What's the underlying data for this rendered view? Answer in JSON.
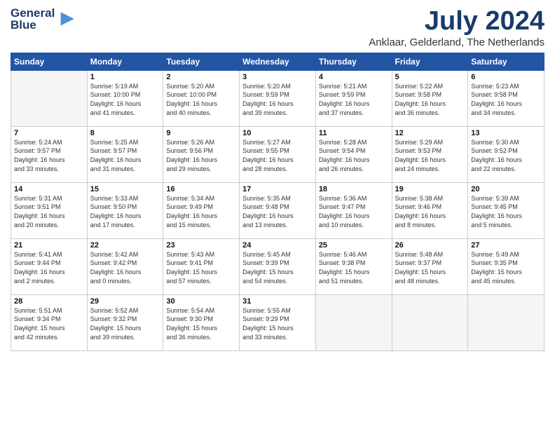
{
  "logo": {
    "line1": "General",
    "line2": "Blue"
  },
  "title": "July 2024",
  "subtitle": "Anklaar, Gelderland, The Netherlands",
  "days_of_week": [
    "Sunday",
    "Monday",
    "Tuesday",
    "Wednesday",
    "Thursday",
    "Friday",
    "Saturday"
  ],
  "weeks": [
    [
      {
        "day": "",
        "content": ""
      },
      {
        "day": "1",
        "content": "Sunrise: 5:19 AM\nSunset: 10:00 PM\nDaylight: 16 hours\nand 41 minutes."
      },
      {
        "day": "2",
        "content": "Sunrise: 5:20 AM\nSunset: 10:00 PM\nDaylight: 16 hours\nand 40 minutes."
      },
      {
        "day": "3",
        "content": "Sunrise: 5:20 AM\nSunset: 9:59 PM\nDaylight: 16 hours\nand 39 minutes."
      },
      {
        "day": "4",
        "content": "Sunrise: 5:21 AM\nSunset: 9:59 PM\nDaylight: 16 hours\nand 37 minutes."
      },
      {
        "day": "5",
        "content": "Sunrise: 5:22 AM\nSunset: 9:58 PM\nDaylight: 16 hours\nand 36 minutes."
      },
      {
        "day": "6",
        "content": "Sunrise: 5:23 AM\nSunset: 9:58 PM\nDaylight: 16 hours\nand 34 minutes."
      }
    ],
    [
      {
        "day": "7",
        "content": "Sunrise: 5:24 AM\nSunset: 9:57 PM\nDaylight: 16 hours\nand 33 minutes."
      },
      {
        "day": "8",
        "content": "Sunrise: 5:25 AM\nSunset: 9:57 PM\nDaylight: 16 hours\nand 31 minutes."
      },
      {
        "day": "9",
        "content": "Sunrise: 5:26 AM\nSunset: 9:56 PM\nDaylight: 16 hours\nand 29 minutes."
      },
      {
        "day": "10",
        "content": "Sunrise: 5:27 AM\nSunset: 9:55 PM\nDaylight: 16 hours\nand 28 minutes."
      },
      {
        "day": "11",
        "content": "Sunrise: 5:28 AM\nSunset: 9:54 PM\nDaylight: 16 hours\nand 26 minutes."
      },
      {
        "day": "12",
        "content": "Sunrise: 5:29 AM\nSunset: 9:53 PM\nDaylight: 16 hours\nand 24 minutes."
      },
      {
        "day": "13",
        "content": "Sunrise: 5:30 AM\nSunset: 9:52 PM\nDaylight: 16 hours\nand 22 minutes."
      }
    ],
    [
      {
        "day": "14",
        "content": "Sunrise: 5:31 AM\nSunset: 9:51 PM\nDaylight: 16 hours\nand 20 minutes."
      },
      {
        "day": "15",
        "content": "Sunrise: 5:33 AM\nSunset: 9:50 PM\nDaylight: 16 hours\nand 17 minutes."
      },
      {
        "day": "16",
        "content": "Sunrise: 5:34 AM\nSunset: 9:49 PM\nDaylight: 16 hours\nand 15 minutes."
      },
      {
        "day": "17",
        "content": "Sunrise: 5:35 AM\nSunset: 9:48 PM\nDaylight: 16 hours\nand 13 minutes."
      },
      {
        "day": "18",
        "content": "Sunrise: 5:36 AM\nSunset: 9:47 PM\nDaylight: 16 hours\nand 10 minutes."
      },
      {
        "day": "19",
        "content": "Sunrise: 5:38 AM\nSunset: 9:46 PM\nDaylight: 16 hours\nand 8 minutes."
      },
      {
        "day": "20",
        "content": "Sunrise: 5:39 AM\nSunset: 9:45 PM\nDaylight: 16 hours\nand 5 minutes."
      }
    ],
    [
      {
        "day": "21",
        "content": "Sunrise: 5:41 AM\nSunset: 9:44 PM\nDaylight: 16 hours\nand 2 minutes."
      },
      {
        "day": "22",
        "content": "Sunrise: 5:42 AM\nSunset: 9:42 PM\nDaylight: 16 hours\nand 0 minutes."
      },
      {
        "day": "23",
        "content": "Sunrise: 5:43 AM\nSunset: 9:41 PM\nDaylight: 15 hours\nand 57 minutes."
      },
      {
        "day": "24",
        "content": "Sunrise: 5:45 AM\nSunset: 9:39 PM\nDaylight: 15 hours\nand 54 minutes."
      },
      {
        "day": "25",
        "content": "Sunrise: 5:46 AM\nSunset: 9:38 PM\nDaylight: 15 hours\nand 51 minutes."
      },
      {
        "day": "26",
        "content": "Sunrise: 5:48 AM\nSunset: 9:37 PM\nDaylight: 15 hours\nand 48 minutes."
      },
      {
        "day": "27",
        "content": "Sunrise: 5:49 AM\nSunset: 9:35 PM\nDaylight: 15 hours\nand 45 minutes."
      }
    ],
    [
      {
        "day": "28",
        "content": "Sunrise: 5:51 AM\nSunset: 9:34 PM\nDaylight: 15 hours\nand 42 minutes."
      },
      {
        "day": "29",
        "content": "Sunrise: 5:52 AM\nSunset: 9:32 PM\nDaylight: 15 hours\nand 39 minutes."
      },
      {
        "day": "30",
        "content": "Sunrise: 5:54 AM\nSunset: 9:30 PM\nDaylight: 15 hours\nand 36 minutes."
      },
      {
        "day": "31",
        "content": "Sunrise: 5:55 AM\nSunset: 9:29 PM\nDaylight: 15 hours\nand 33 minutes."
      },
      {
        "day": "",
        "content": ""
      },
      {
        "day": "",
        "content": ""
      },
      {
        "day": "",
        "content": ""
      }
    ]
  ]
}
